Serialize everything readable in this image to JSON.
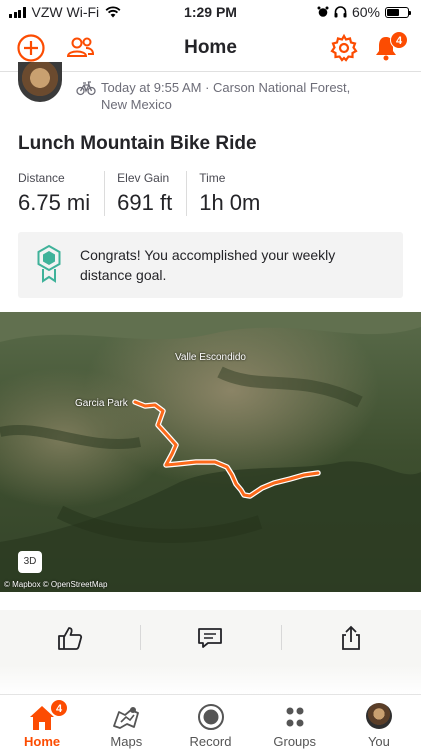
{
  "status_bar": {
    "carrier": "VZW Wi-Fi",
    "time": "1:29 PM",
    "battery": "60%"
  },
  "header": {
    "title": "Home",
    "notifications_count": "4"
  },
  "activity": {
    "meta_line1": "Today at 9:55 AM · Carson National Forest,",
    "meta_line2": "New Mexico",
    "title": "Lunch Mountain Bike Ride",
    "stats": [
      {
        "label": "Distance",
        "value": "6.75 mi"
      },
      {
        "label": "Elev Gain",
        "value": "691 ft"
      },
      {
        "label": "Time",
        "value": "1h 0m"
      }
    ],
    "goal_text": "Congrats! You accomplished your weekly distance goal."
  },
  "map": {
    "label_valle": "Valle Escondido",
    "label_garcia": "Garcia Park",
    "button_3d": "3D",
    "credit": "© Mapbox © OpenStreetMap"
  },
  "tabbar": {
    "items": [
      {
        "label": "Home",
        "badge": "4"
      },
      {
        "label": "Maps"
      },
      {
        "label": "Record"
      },
      {
        "label": "Groups"
      },
      {
        "label": "You"
      }
    ]
  },
  "colors": {
    "accent": "#fc4c02",
    "goal_icon": "#3fb29a"
  }
}
